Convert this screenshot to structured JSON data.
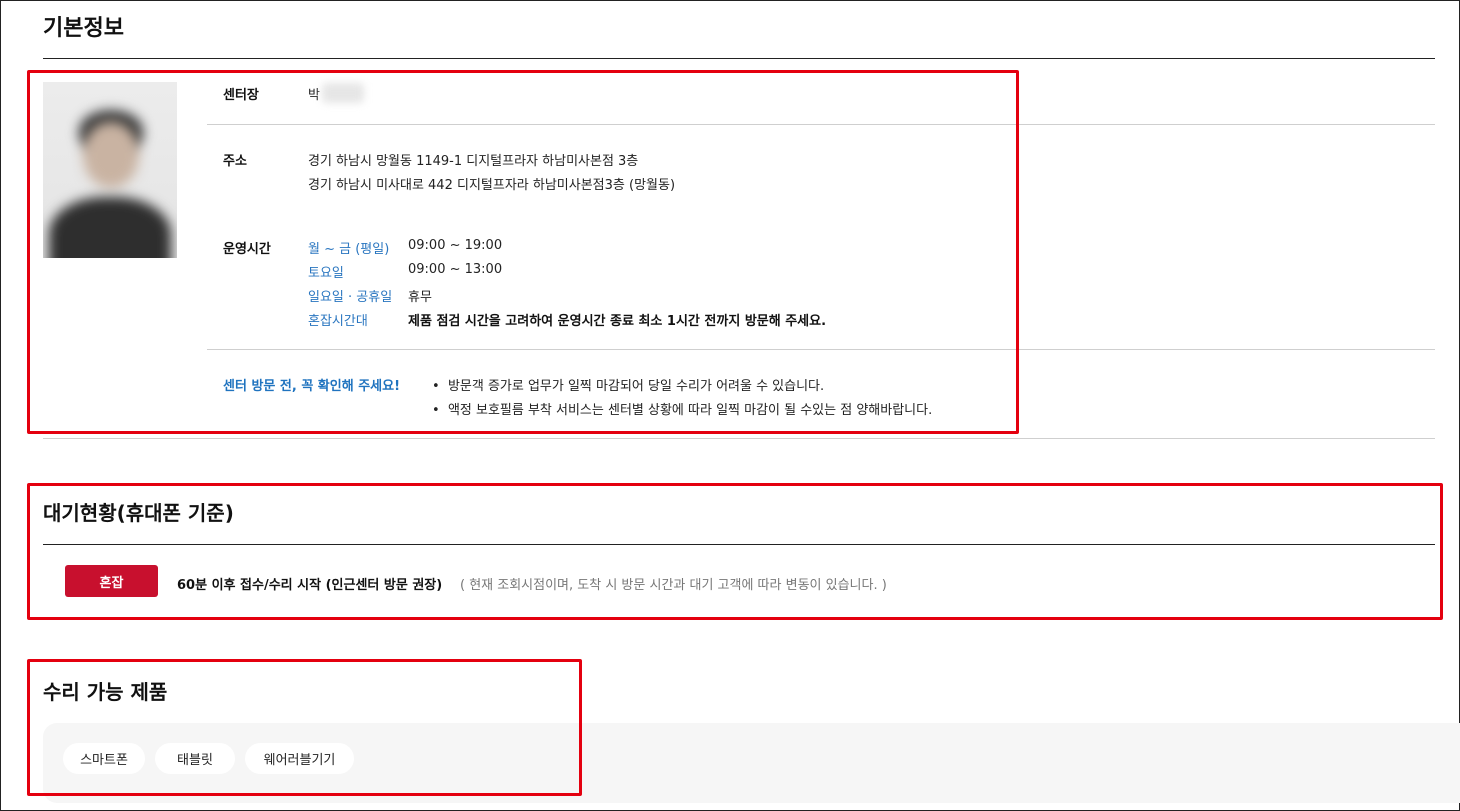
{
  "basic_info": {
    "title": "기본정보",
    "center_head_label": "센터장",
    "center_head_value": "박",
    "address_label": "주소",
    "address_lines": [
      "경기 하남시 망월동 1149-1 디지털프라자 하남미사본점 3층",
      "경기 하남시 미사대로 442 디지털프자라 하남미사본점3층 (망월동)"
    ],
    "hours_label": "운영시간",
    "hours": [
      {
        "day": "월 ~ 금 (평일)",
        "time": "09:00 ~ 19:00"
      },
      {
        "day": "토요일",
        "time": "09:00 ~ 13:00"
      },
      {
        "day": "일요일 · 공휴일",
        "time": "휴무"
      },
      {
        "day": "혼잡시간대",
        "time": "제품 점검 시간을 고려하여 운영시간 종료 최소 1시간 전까지 방문해 주세요."
      }
    ],
    "notice_label": "센터 방문 전, 꼭 확인해 주세요!",
    "notices": [
      "방문객 증가로 업무가 일찍 마감되어 당일 수리가 어려울 수 있습니다.",
      "액정 보호필름 부착 서비스는 센터별 상황에 따라 일찍 마감이 될 수있는 점 양해바랍니다."
    ]
  },
  "waiting": {
    "title": "대기현황(휴대폰 기준)",
    "badge": "혼잡",
    "status": "60분 이후 접수/수리 시작 (인근센터 방문 권장)",
    "note": "( 현재 조회시점이며, 도착 시 방문 시간과 대기 고객에 따라 변동이 있습니다. )"
  },
  "products": {
    "title": "수리 가능 제품",
    "items": [
      "스마트폰",
      "태블릿",
      "웨어러블기기"
    ]
  },
  "colors": {
    "accent_red": "#c8102e",
    "highlight_box": "#e4000f",
    "link_blue": "#2a76c0"
  }
}
